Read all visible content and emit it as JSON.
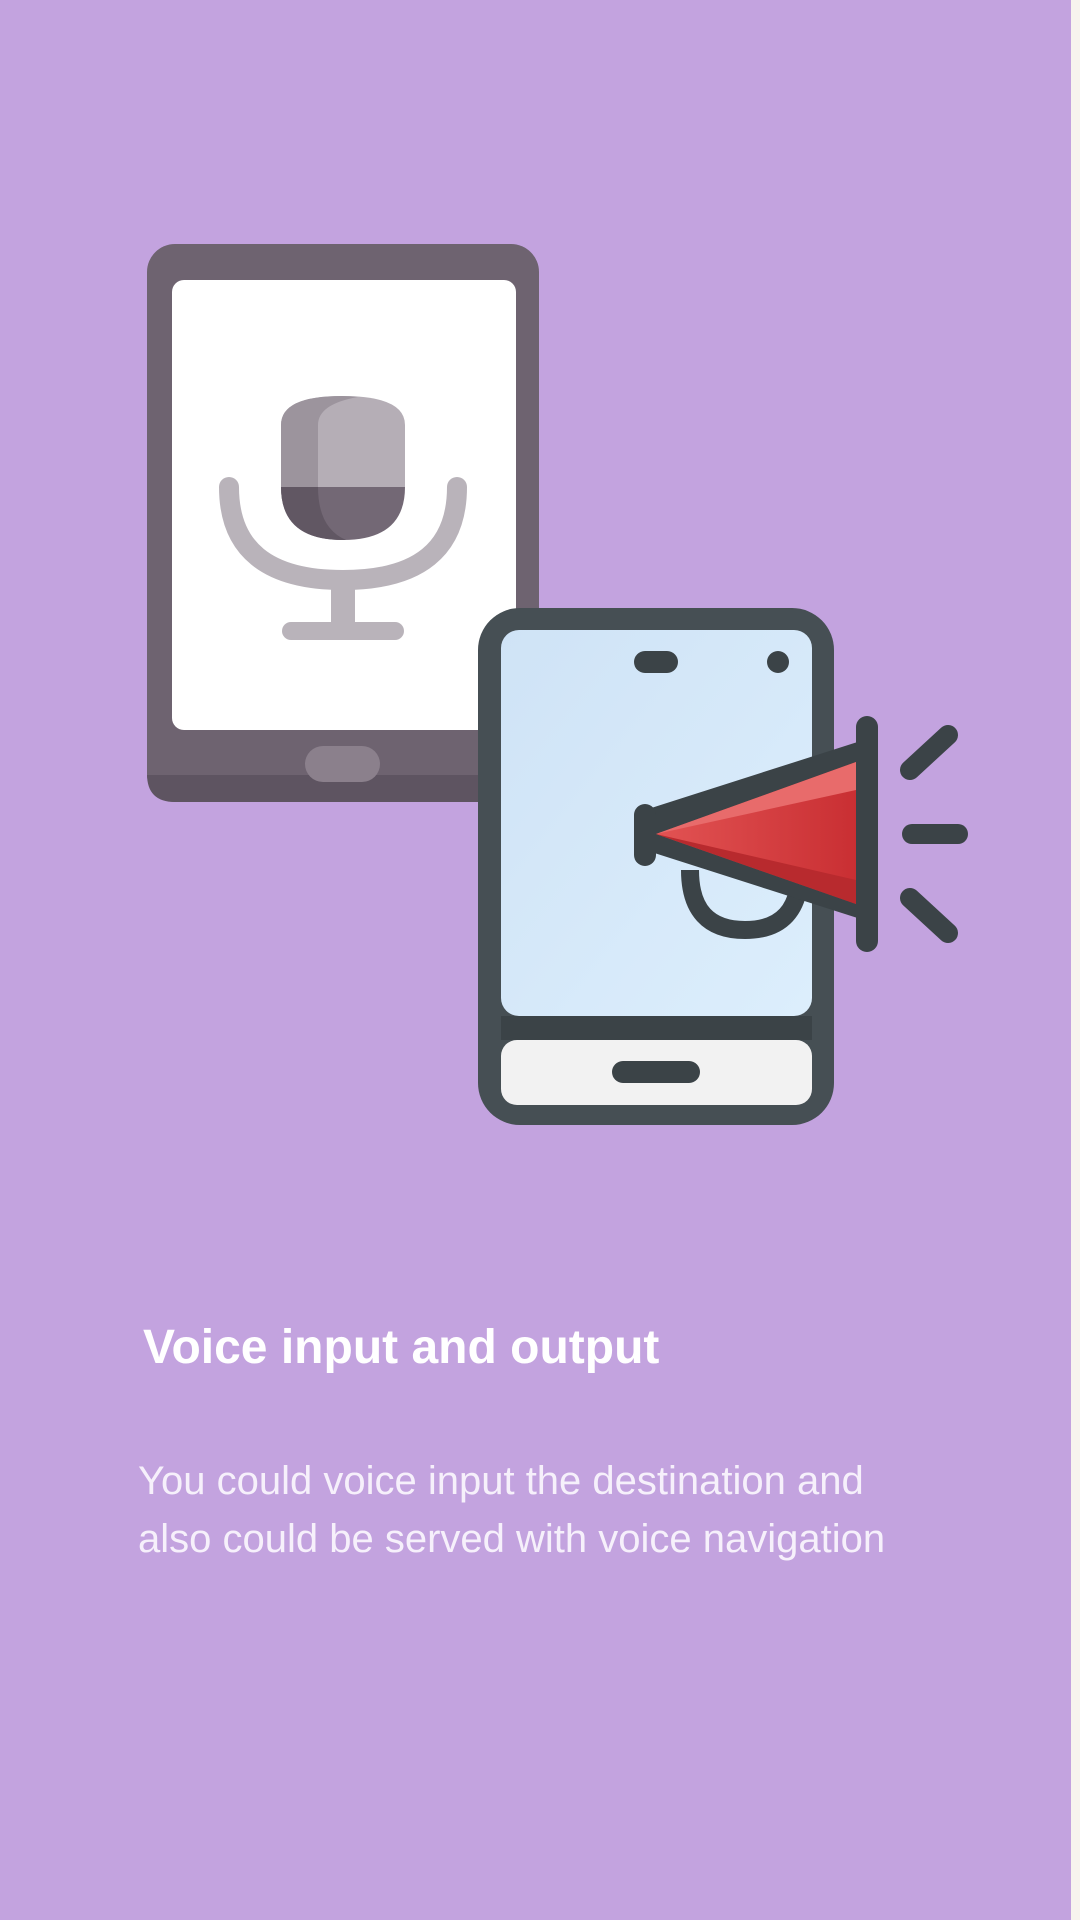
{
  "onboarding": {
    "title": "Voice input and output",
    "description_lines": [
      "You could voice input the destination and",
      "also could be served with voice navigation"
    ]
  },
  "illustration": {
    "tablet_icon": "tablet-microphone-icon",
    "phone_icon": "phone-megaphone-icon"
  },
  "colors": {
    "background": "#c3a3df",
    "text": "#ffffff",
    "megaphone_red": "#d83a3a",
    "device_dark": "#3b4347",
    "tablet_frame": "#6e6370"
  }
}
